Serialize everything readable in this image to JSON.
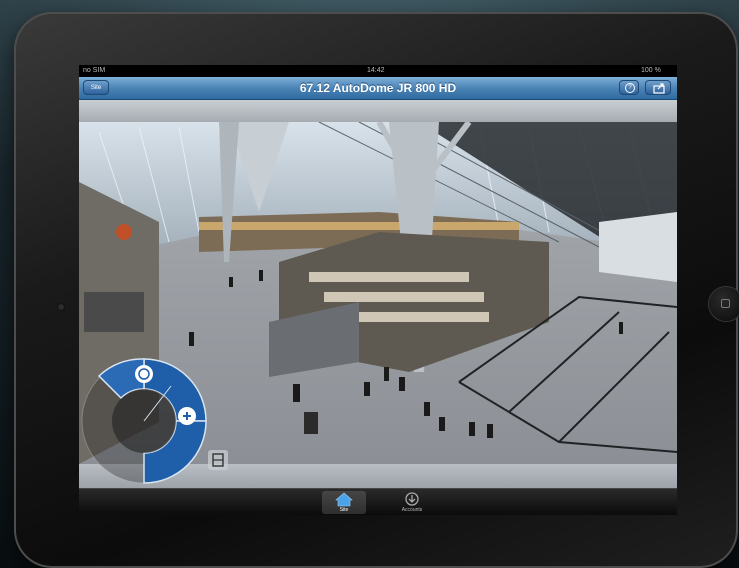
{
  "status_bar": {
    "carrier": "no SIM",
    "time": "14:42",
    "battery": "100 %"
  },
  "nav_bar": {
    "title": "67.12 AutoDome JR 800 HD",
    "site_label": "Site"
  },
  "tab_bar": {
    "tabs": [
      {
        "label": "Site",
        "icon": "home-icon",
        "active": true
      },
      {
        "label": "Accounts",
        "icon": "accounts-icon",
        "active": false
      }
    ]
  },
  "colors": {
    "nav_bar": "#4c84b6",
    "tablet_bezel": "#1a1a1a",
    "ptz_blue": "#1f5ea8"
  }
}
